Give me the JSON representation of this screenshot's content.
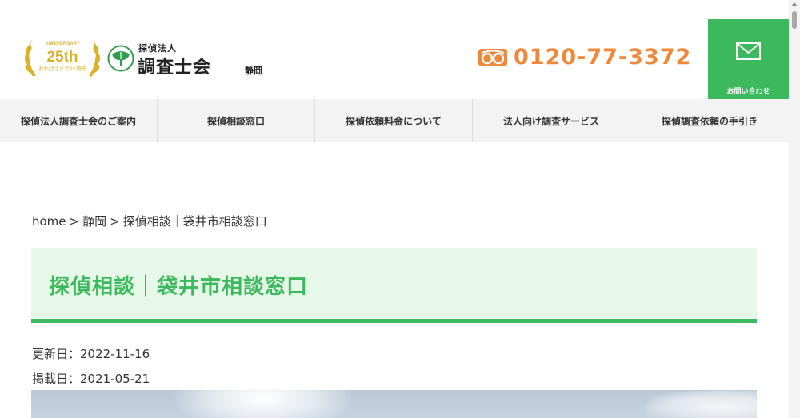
{
  "header": {
    "badge": {
      "top_text": "ANNIVERSARY",
      "years": "25th",
      "bottom_text": "おかげさまで25周年"
    },
    "logo": {
      "top": "探偵法人",
      "main": "調査士会",
      "region": "静岡",
      "mark_icon": "ginkgo-leaf-icon"
    },
    "phone": {
      "icon": "free-dial-icon",
      "number": "0120-77-3372"
    },
    "contact": {
      "icon": "mail-icon",
      "label": "お問い合わせ"
    }
  },
  "nav": {
    "items": [
      {
        "label": "探偵法人調査士会のご案内"
      },
      {
        "label": "探偵相談窓口"
      },
      {
        "label": "探偵依頼料金について"
      },
      {
        "label": "法人向け調査サービス"
      },
      {
        "label": "探偵調査依頼の手引き"
      }
    ]
  },
  "breadcrumb": {
    "items": [
      "home",
      "静岡",
      "探偵相談｜袋井市相談窓口"
    ],
    "separator": ">"
  },
  "main": {
    "title": "探偵相談｜袋井市相談窓口",
    "updated": "更新日：2022-11-16",
    "posted": "掲載日：2021-05-21"
  },
  "colors": {
    "accent_green": "#3cb95c",
    "title_bg": "#e6f8e8",
    "phone_orange": "#f0883a",
    "badge_gold": "#d9b12a"
  }
}
